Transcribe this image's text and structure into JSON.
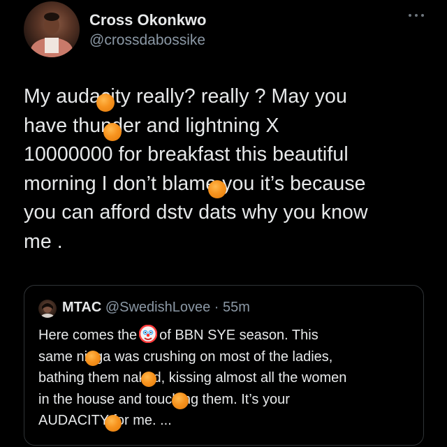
{
  "author": {
    "name": "Cross Okonkwo",
    "handle": "@crossdabossike"
  },
  "tweet": {
    "lines": [
      "My audacity really? really ? May you",
      "have thunder and lightning X",
      "10000000 for breakfast this beautiful",
      "morning I don’t blame you it’s because",
      "you can afford dstv dats why you know",
      "me ."
    ]
  },
  "quoted": {
    "name": "MTAC",
    "handle": "@SwedishLovee",
    "separator": "·",
    "time": "55m",
    "line1_before": "Here comes the",
    "line1_after": "of BBN SYE season. This",
    "lines": [
      "same nigga was crushing on most of the ladies,",
      "bathing them naked, kissing almost all the women",
      "in the house and touching them. It’s your",
      "AUDACITY for me. ..."
    ]
  },
  "icons": {
    "more": "more-horizontal-icon",
    "clown": "clown-face-emoji",
    "censor": "orange-censor-dot"
  },
  "colors": {
    "background": "#000000",
    "text": "#e7e9ea",
    "secondary": "#8b98a5",
    "border": "#2f3336",
    "censor": "#f7931e"
  }
}
